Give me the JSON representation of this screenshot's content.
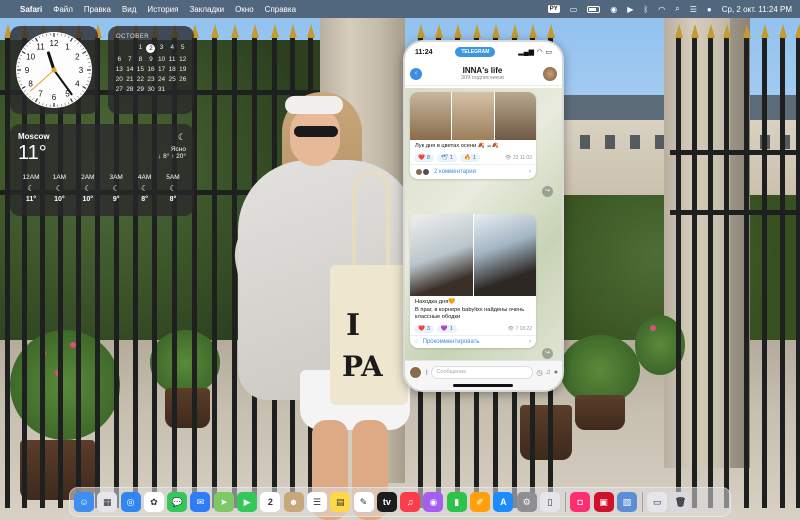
{
  "menubar": {
    "app_name": "Safari",
    "menus": [
      "Файл",
      "Правка",
      "Вид",
      "История",
      "Закладки",
      "Окно",
      "Справка"
    ],
    "input_source": "PY",
    "datetime": "Ср, 2 окт.  11:24 PM"
  },
  "calendar": {
    "month": "OCTOBER",
    "today": "2",
    "weeks": [
      [
        "",
        "",
        "1",
        "2",
        "3",
        "4",
        "5"
      ],
      [
        "6",
        "7",
        "8",
        "9",
        "10",
        "11",
        "12"
      ],
      [
        "13",
        "14",
        "15",
        "16",
        "17",
        "18",
        "19"
      ],
      [
        "20",
        "21",
        "22",
        "23",
        "24",
        "25",
        "26"
      ],
      [
        "27",
        "28",
        "29",
        "30",
        "31",
        "",
        ""
      ]
    ]
  },
  "clock": {
    "hour": 11,
    "minute": 24
  },
  "weather": {
    "city": "Moscow",
    "temp": "11°",
    "condition": "Ясно",
    "hilo": "↓ 8° ↑ 20°",
    "hours": [
      {
        "time": "12AM",
        "icon": "moon-icon",
        "temp": "11°"
      },
      {
        "time": "1AM",
        "icon": "moon-icon",
        "temp": "10°"
      },
      {
        "time": "2AM",
        "icon": "moon-icon",
        "temp": "10°"
      },
      {
        "time": "3AM",
        "icon": "moon-icon",
        "temp": "9°"
      },
      {
        "time": "4AM",
        "icon": "moon-icon",
        "temp": "8°"
      },
      {
        "time": "5AM",
        "icon": "moon-icon",
        "temp": "8°"
      }
    ]
  },
  "phone": {
    "time": "11:24",
    "island_label": "TELEGRAM",
    "channel_name": "INNA's life",
    "subscribers": "309 подписчиков",
    "post1": {
      "text": "Лук дня в цветах осени 🍂 ☕🍂",
      "reactions": [
        {
          "emoji": "❤️",
          "count": "8"
        },
        {
          "emoji": "🕊",
          "count": "1"
        },
        {
          "emoji": "🔥",
          "count": "1"
        }
      ],
      "meta": "👁 23 11:03",
      "comments": "2 комментария"
    },
    "post2": {
      "text": "Находка дня🧡\nВ праг, в корнере babylixx найдены очень классные ободки",
      "reactions": [
        {
          "emoji": "❤️",
          "count": "3"
        },
        {
          "emoji": "💜",
          "count": "1"
        }
      ],
      "meta": "👁 7 18:22",
      "comments": "Прокомментировать"
    },
    "input_placeholder": "Сообщение"
  },
  "dock": {
    "apps": [
      {
        "name": "finder",
        "color": "#3d8ef0",
        "glyph": "☺"
      },
      {
        "name": "launchpad",
        "color": "#e5e5ea",
        "glyph": "▦"
      },
      {
        "name": "safari",
        "color": "#2f86f0",
        "glyph": "◎"
      },
      {
        "name": "photos",
        "color": "#ffffff",
        "glyph": "✿"
      },
      {
        "name": "messages",
        "color": "#34c759",
        "glyph": "💬"
      },
      {
        "name": "mail",
        "color": "#2f7cf6",
        "glyph": "✉"
      },
      {
        "name": "maps",
        "color": "#7fc868",
        "glyph": "➤"
      },
      {
        "name": "facetime",
        "color": "#34c759",
        "glyph": "▶"
      },
      {
        "name": "calendar",
        "color": "#ffffff",
        "glyph": "2"
      },
      {
        "name": "contacts",
        "color": "#c8a77c",
        "glyph": "☻"
      },
      {
        "name": "reminders",
        "color": "#ffffff",
        "glyph": "☰"
      },
      {
        "name": "notes",
        "color": "#ffd84a",
        "glyph": "▤"
      },
      {
        "name": "freeform",
        "color": "#ffffff",
        "glyph": "✎"
      },
      {
        "name": "tv",
        "color": "#1c1c1e",
        "glyph": "tv"
      },
      {
        "name": "music",
        "color": "#fa3c4c",
        "glyph": "♫"
      },
      {
        "name": "podcasts",
        "color": "#a55ef0",
        "glyph": "◉"
      },
      {
        "name": "numbers",
        "color": "#2cc34a",
        "glyph": "▮"
      },
      {
        "name": "pages",
        "color": "#ff9f0a",
        "glyph": "✐"
      },
      {
        "name": "app-store",
        "color": "#1a8cff",
        "glyph": "A"
      },
      {
        "name": "system-settings",
        "color": "#8e8e93",
        "glyph": "⚙"
      },
      {
        "name": "iphone-mirroring",
        "color": "#e5e5ea",
        "glyph": "▯"
      },
      {
        "name": "separator",
        "color": "",
        "glyph": ""
      },
      {
        "name": "screenshot",
        "color": "#ff2d6f",
        "glyph": "◘"
      },
      {
        "name": "photo-booth",
        "color": "#d0112b",
        "glyph": "▣"
      },
      {
        "name": "preview",
        "color": "#5a8fd6",
        "glyph": "▧"
      },
      {
        "name": "separator2",
        "color": "",
        "glyph": ""
      },
      {
        "name": "downloads",
        "color": "#e5e5ea",
        "glyph": "▭"
      },
      {
        "name": "trash",
        "color": "#d9d9de",
        "glyph": "🗑"
      }
    ]
  }
}
